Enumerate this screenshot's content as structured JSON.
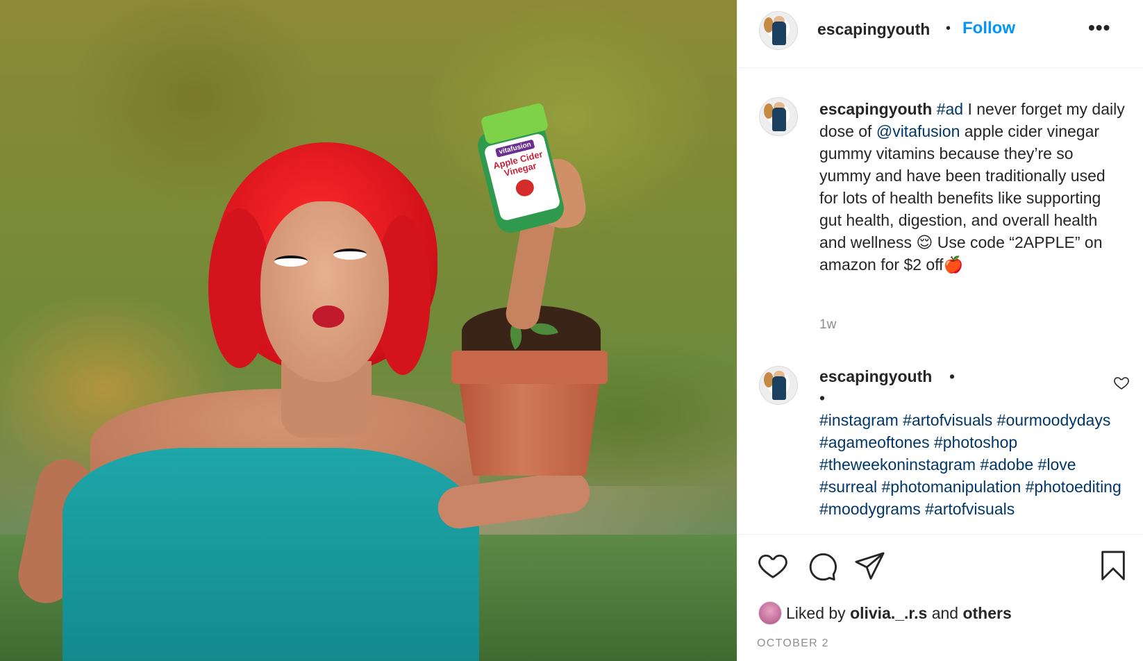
{
  "post": {
    "photo_alt": "Woman with red hair holding a plant pot with a hand holding a vitafusion bottle",
    "bottle": {
      "brand": "vitafusion",
      "name_line1": "Apple Cider",
      "name_line2": "Vinegar"
    }
  },
  "header": {
    "username": "escapingyouth",
    "separator": "•",
    "follow_label": "Follow",
    "more_label": "•••"
  },
  "caption": {
    "username": "escapingyouth",
    "tag_ad": "#ad",
    "text_1": " I never forget my daily dose of ",
    "mention": "@vitafusion",
    "text_2": " apple cider vinegar gummy vitamins because they’re so yummy and have been traditionally used for lots of health benefits like supporting gut health, digestion, and overall health and wellness 😌 Use code “2APPLE” on amazon for $2 off🍎",
    "time": "1w"
  },
  "comment": {
    "username": "escapingyouth",
    "dot1": "•",
    "dot2": "•",
    "tags": "#instagram #artofvisuals #ourmoodydays #agameoftones #photoshop #theweekoninstagram #adobe #love #surreal #photomanipulation #photoediting #moodygrams #artofvisuals"
  },
  "actions": {
    "icons": [
      "heart-icon",
      "comment-icon",
      "share-icon",
      "bookmark-icon"
    ]
  },
  "likes": {
    "prefix": "Liked by ",
    "user": "olivia._.r.s",
    "middle": " and ",
    "others": "others"
  },
  "date": "OCTOBER 2",
  "colors": {
    "link": "#0095f6",
    "hashtag": "#00376b",
    "muted": "#8e8e8e",
    "text": "#262626"
  }
}
